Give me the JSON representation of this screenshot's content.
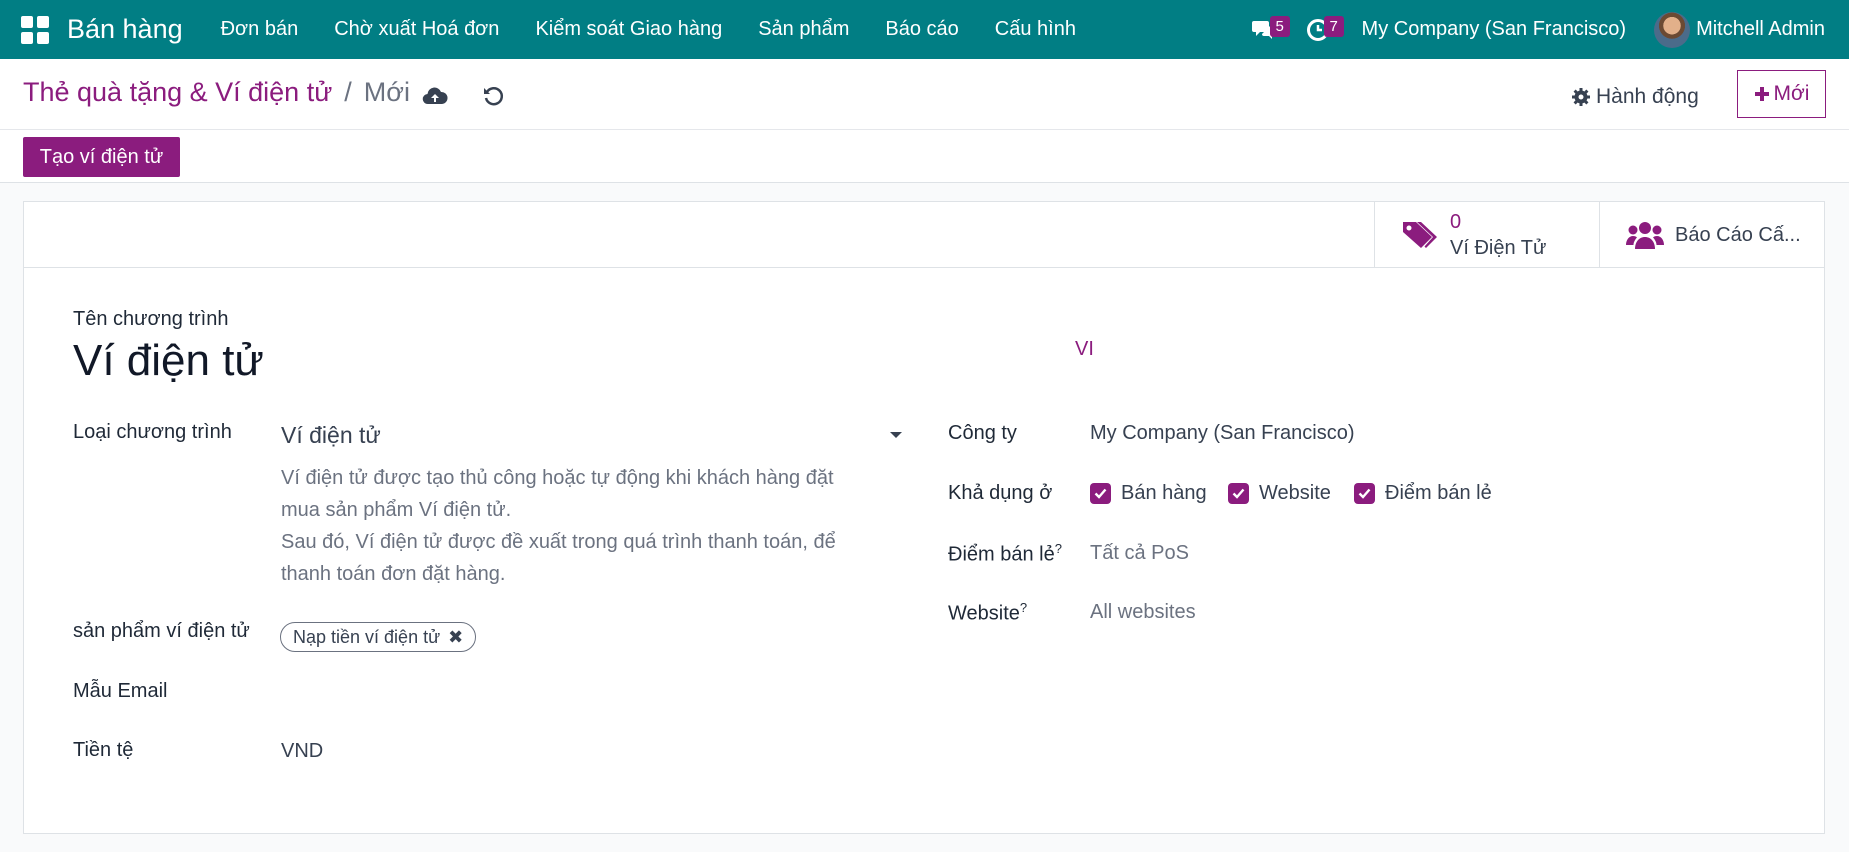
{
  "navbar": {
    "app_name": "Bán hàng",
    "menu": [
      "Đơn bán",
      "Chờ xuất Hoá đơn",
      "Kiểm soát Giao hàng",
      "Sản phẩm",
      "Báo cáo",
      "Cấu hình"
    ],
    "messages_count": "5",
    "activities_count": "7",
    "company": "My Company (San Francisco)",
    "user": "Mitchell Admin"
  },
  "control_panel": {
    "breadcrumb_parent": "Thẻ quà tặng & Ví điện tử",
    "breadcrumb_separator": "/",
    "breadcrumb_current": "Mới",
    "action_label": "Hành động",
    "new_label": "Mới",
    "create_wallet_label": "Tạo ví điện tử"
  },
  "stats": {
    "wallet_count": "0",
    "wallet_label": "Ví Điện Tử",
    "report_label": "Báo Cáo Cấ..."
  },
  "form": {
    "program_name_label": "Tên chương trình",
    "program_name": "Ví điện tử",
    "lang_code": "VI",
    "program_type_label": "Loại chương trình",
    "program_type": "Ví điện tử",
    "help_line_1": "Ví điện tử được tạo thủ công hoặc tự động khi khách hàng đặt",
    "help_line_2": "mua sản phẩm Ví điện tử.",
    "help_line_3": "Sau đó, Ví điện tử được đề xuất trong quá trình thanh toán, để",
    "help_line_4": "thanh toán đơn đặt hàng.",
    "wallet_product_label": "sản phẩm ví điện tử",
    "wallet_product_tag": "Nạp tiền ví điện tử",
    "email_template_label": "Mẫu Email",
    "currency_label": "Tiền tệ",
    "currency": "VND",
    "company_label": "Công ty",
    "company": "My Company (San Francisco)",
    "available_label": "Khả dụng ở",
    "available": [
      "Bán hàng",
      "Website",
      "Điểm bán lẻ"
    ],
    "pos_label": "Điểm bán lẻ",
    "pos_value": "Tất cả PoS",
    "website_label": "Website",
    "website_value": "All websites",
    "help_mark": "?"
  },
  "colors": {
    "navbar": "#017e84",
    "accent": "#8b1c7e"
  }
}
